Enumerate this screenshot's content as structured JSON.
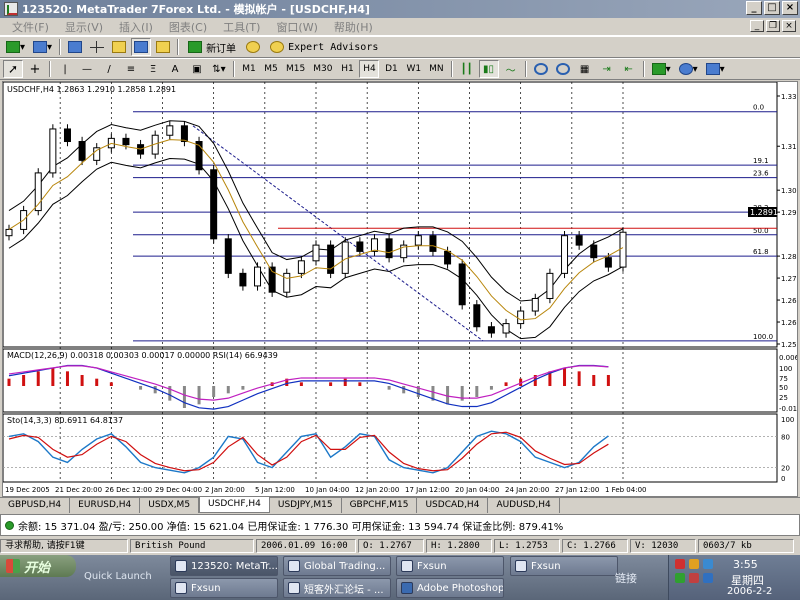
{
  "window": {
    "title": "123520: MetaTrader 7Forex Ltd. - 模拟帐户 - [USDCHF,H4]"
  },
  "menu": {
    "items": [
      "文件(F)",
      "显示(V)",
      "插入(I)",
      "图表(C)",
      "工具(T)",
      "窗口(W)",
      "帮助(H)"
    ]
  },
  "toolbar1": {
    "new_order": "新订单",
    "expert_advisors": "Expert Advisors"
  },
  "toolbar2": {
    "timeframes": [
      "M1",
      "M5",
      "M15",
      "M30",
      "H1",
      "H4",
      "D1",
      "W1",
      "MN"
    ],
    "active_timeframe": "H4"
  },
  "chart": {
    "header": "USDCHF,H4  1.2863 1.2910 1.2858 1.2891",
    "current_price": "1.2891",
    "macd_label": "MACD(12,26,9) 0.00318 0.00303 0.00017 0.00000  RSI(14) 66.9439",
    "stoch_label": "Sto(14,3,3) 80.6911 64.8137",
    "fib_labels": [
      "0.0",
      "19.1",
      "23.6",
      "38.2",
      "50.0",
      "61.8",
      "100.0"
    ],
    "price_axis": [
      "1.3325",
      "1.3165",
      "1.3025",
      "1.2955",
      "1.2815",
      "1.2745",
      "1.2675",
      "1.2605",
      "1.2535"
    ],
    "macd_axis": [
      "0.0067",
      "100",
      "75",
      "50",
      "25",
      "-0.01032"
    ],
    "stoch_axis": [
      "100",
      "80",
      "20",
      "0"
    ],
    "time_axis": [
      "19 Dec 2005",
      "21 Dec 20:00",
      "26 Dec 12:00",
      "29 Dec 04:00",
      "2 Jan 20:00",
      "5 Jan 12:00",
      "10 Jan 04:00",
      "12 Jan 20:00",
      "17 Jan 12:00",
      "20 Jan 04:00",
      "24 Jan 20:00",
      "27 Jan 12:00",
      "1 Feb 04:00"
    ]
  },
  "tabs": [
    "GBPUSD,H4",
    "EURUSD,H4",
    "USDX,M5",
    "USDCHF,H4",
    "USDJPY,M15",
    "GBPCHF,M15",
    "USDCAD,H4",
    "AUDUSD,H4"
  ],
  "active_tab": "USDCHF,H4",
  "account": {
    "text": "余额: 15 371.04  盈/亏: 250.00  净值: 15 621.04  已用保证金: 1 776.30  可用保证金: 13 594.74  保证金比例: 879.41%"
  },
  "status": {
    "help": "寻求帮助, 请按F1键",
    "profile": "British Pound",
    "datetime": "2006.01.09 16:00",
    "open": "O: 1.2767",
    "high": "H: 1.2800",
    "low": "L: 1.2753",
    "close": "C: 1.2766",
    "volume": "V: 12030",
    "traffic": "0603/7 kb"
  },
  "taskbar": {
    "start_label": "开始",
    "quick_launch": "Quick Launch",
    "tasks": [
      "123520: MetaTr...",
      "Global Trading...",
      "Fxsun",
      "Fxsun",
      "Fxsun",
      "短客外汇论坛 - ...",
      "Adobe Photoshop"
    ],
    "link_label": "链接",
    "time": "3:55",
    "weekday": "星期四",
    "date": "2006-2-2"
  },
  "chart_data": {
    "type": "line",
    "instrument": "USDCHF",
    "timeframe": "H4",
    "ylim": [
      1.2535,
      1.3325
    ],
    "fibonacci_levels": [
      {
        "label": "0.0",
        "price": 1.3275
      },
      {
        "label": "19.1",
        "price": 1.3105
      },
      {
        "label": "23.6",
        "price": 1.3065
      },
      {
        "label": "38.2",
        "price": 1.2955
      },
      {
        "label": "50.0",
        "price": 1.2883
      },
      {
        "label": "61.8",
        "price": 1.2815
      },
      {
        "label": "100.0",
        "price": 1.2545
      }
    ],
    "close_series": [
      1.29,
      1.296,
      1.308,
      1.322,
      1.318,
      1.312,
      1.316,
      1.319,
      1.317,
      1.314,
      1.32,
      1.323,
      1.318,
      1.309,
      1.287,
      1.276,
      1.272,
      1.278,
      1.27,
      1.276,
      1.28,
      1.285,
      1.276,
      1.286,
      1.283,
      1.287,
      1.281,
      1.285,
      1.288,
      1.283,
      1.279,
      1.266,
      1.259,
      1.257,
      1.26,
      1.264,
      1.268,
      1.276,
      1.288,
      1.285,
      1.281,
      1.278,
      1.2891
    ],
    "macd_hist": [
      0.002,
      0.003,
      0.004,
      0.005,
      0.004,
      0.003,
      0.002,
      0.001,
      0.0,
      -0.001,
      -0.002,
      -0.004,
      -0.006,
      -0.005,
      -0.003,
      -0.002,
      -0.001,
      0.0,
      0.001,
      0.002,
      0.001,
      0.0,
      0.001,
      0.002,
      0.001,
      0.0,
      -0.001,
      -0.002,
      -0.003,
      -0.004,
      -0.005,
      -0.004,
      -0.003,
      -0.001,
      0.001,
      0.002,
      0.003,
      0.004,
      0.005,
      0.004,
      0.003,
      0.003
    ],
    "stoch_main": [
      80,
      85,
      70,
      40,
      30,
      55,
      75,
      85,
      60,
      30,
      20,
      15,
      10,
      20,
      40,
      80,
      75,
      30,
      20,
      50,
      80,
      85,
      40,
      60,
      85,
      80,
      35,
      20,
      15,
      10,
      20,
      50,
      80,
      90,
      85,
      70,
      40,
      30,
      20,
      30,
      60,
      81
    ],
    "stoch_signal": [
      75,
      82,
      78,
      55,
      40,
      45,
      65,
      80,
      70,
      45,
      28,
      20,
      14,
      16,
      30,
      60,
      78,
      45,
      25,
      40,
      70,
      82,
      55,
      55,
      78,
      82,
      50,
      28,
      18,
      14,
      16,
      38,
      65,
      85,
      88,
      78,
      52,
      38,
      26,
      28,
      48,
      65
    ]
  }
}
